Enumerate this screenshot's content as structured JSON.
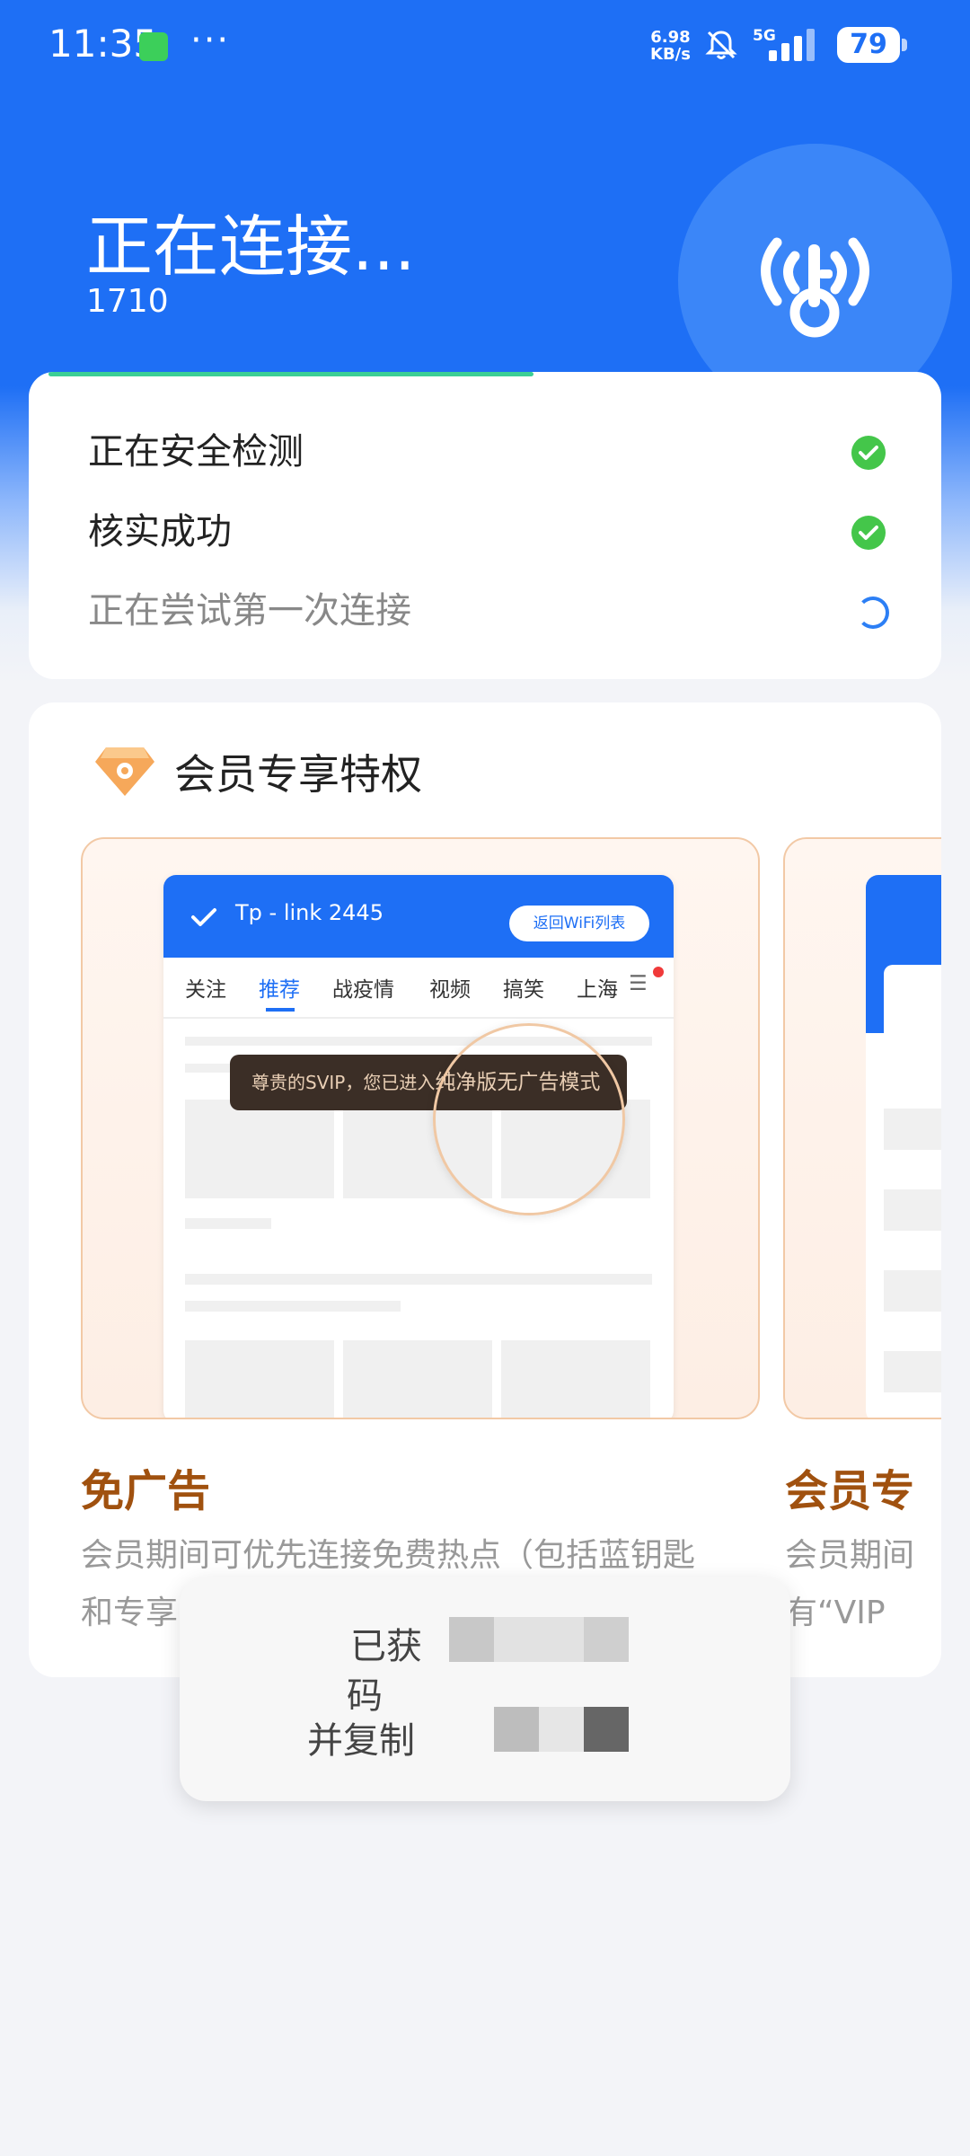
{
  "status_bar": {
    "time": "11:35",
    "dots": "···",
    "speed_value": "6.98",
    "speed_unit": "KB/s",
    "network": "5G",
    "battery": "79"
  },
  "header": {
    "title": "正在连接...",
    "subtitle": "1710",
    "icon": "wifi-key-icon"
  },
  "steps": [
    {
      "label": "正在安全检测",
      "state": "done"
    },
    {
      "label": "核实成功",
      "state": "done"
    },
    {
      "label": "正在尝试第一次连接",
      "state": "loading"
    }
  ],
  "vip": {
    "title": "会员专享特权",
    "icon": "diamond-icon",
    "mock": {
      "ssid": "Tp - link 2445",
      "back_button": "返回WiFi列表",
      "tabs": [
        "关注",
        "推荐",
        "战疫情",
        "视频",
        "搞笑",
        "上海"
      ],
      "tooltip_prefix": "尊贵的SVIP，您已进入",
      "tooltip_highlight": "纯净版无广告模式"
    },
    "features": [
      {
        "name": "免广告",
        "desc_line1": "会员期间可优先连接免费热点（包括蓝钥匙",
        "desc_line2": "和专享"
      },
      {
        "name": "会员专",
        "desc_line1": "会员期间",
        "desc_line2": "有“VIP"
      }
    ]
  },
  "toast": {
    "line1": "已获",
    "line2": "码",
    "line3": "并复制"
  },
  "colors": {
    "brand_blue": "#1e6ff5",
    "success_green": "#44c64a",
    "vip_brown": "#a0510f"
  }
}
